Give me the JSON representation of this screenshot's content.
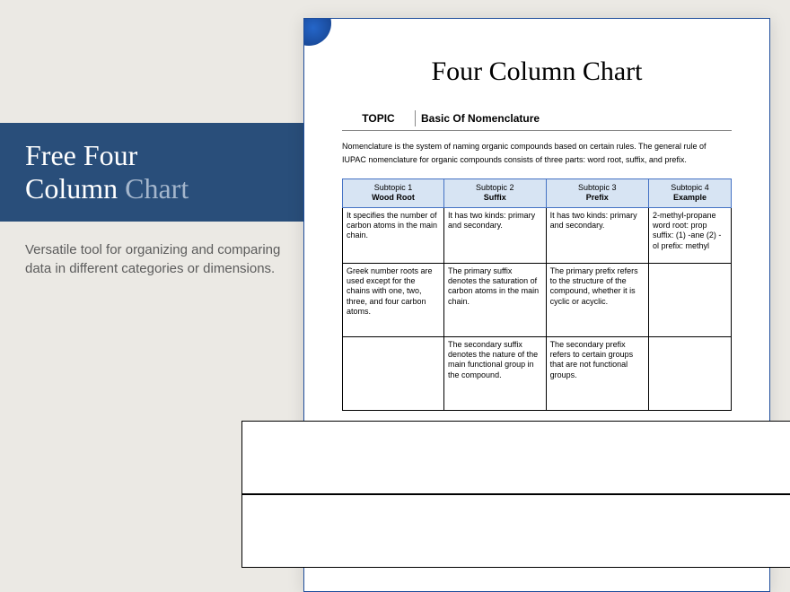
{
  "banner": {
    "word1": "Free",
    "word2": "Four",
    "word3": "Column",
    "word4": "Chart"
  },
  "description": "Versatile tool for organizing and comparing data in different categories or dimensions.",
  "document": {
    "title": "Four Column Chart",
    "topic_label": "TOPIC",
    "topic_value": "Basic Of Nomenclature",
    "intro": "Nomenclature is the system of naming organic compounds based on certain rules. The general rule of IUPAC nomenclature for organic compounds consists of three parts: word root, suffix, and prefix.",
    "headers": [
      {
        "sub": "Subtopic 1",
        "name": "Wood Root"
      },
      {
        "sub": "Subtopic 2",
        "name": "Suffix"
      },
      {
        "sub": "Subtopic 3",
        "name": "Prefix"
      },
      {
        "sub": "Subtopic 4",
        "name": "Example"
      }
    ],
    "rows": [
      [
        "It specifies the number of carbon atoms in the main chain.",
        "It has two kinds: primary and secondary.",
        "It has two kinds: primary and secondary.",
        "2-methyl-propane word root: prop suffix: (1) -ane (2) -ol prefix: methyl"
      ],
      [
        "Greek number roots are used except for the chains with one, two, three, and four carbon atoms.",
        "The primary suffix denotes the saturation of carbon atoms in the main chain.",
        "The primary prefix refers to the structure of the compound, whether it is cyclic or acyclic.",
        ""
      ],
      [
        "",
        "The secondary suffix denotes the nature of the main functional group in the compound.",
        "The secondary prefix refers to certain groups that are not functional groups.",
        ""
      ]
    ]
  }
}
